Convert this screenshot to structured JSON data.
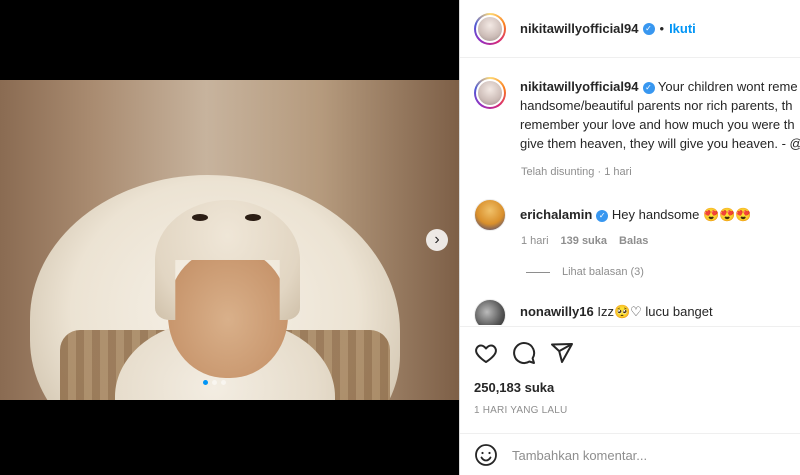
{
  "post": {
    "username": "nikitawillyofficial94",
    "verified_icon": "verified-badge-icon",
    "separator": "•",
    "follow_label": "Ikuti"
  },
  "caption": {
    "username": "nikitawillyofficial94",
    "lines": [
      "Your children wont reme",
      "handsome/beautiful parents nor rich parents, th",
      "remember your love and how much you were th",
      "give them heaven, they will give you heaven. - @"
    ],
    "edited": "Telah disunting",
    "dot": "·",
    "time": "1 hari"
  },
  "comments": [
    {
      "username": "erichalamin",
      "text": "Hey handsome 😍😍😍",
      "time": "1 hari",
      "likes": "139 suka",
      "reply": "Balas",
      "view_replies": "Lihat balasan (3)"
    },
    {
      "username": "nonawilly16",
      "text": "Izz🥺♡ lucu banget"
    }
  ],
  "actions": {
    "like_icon": "heart-icon",
    "comment_icon": "comment-icon",
    "share_icon": "send-icon",
    "likes_count": "250,183 suka",
    "timestamp": "1 HARI YANG LALU",
    "comment_placeholder": "Tambahkan komentar...",
    "emoji_icon": "emoji-icon"
  },
  "media": {
    "next_label": "›",
    "carousel_total": 3,
    "carousel_active": 1
  }
}
